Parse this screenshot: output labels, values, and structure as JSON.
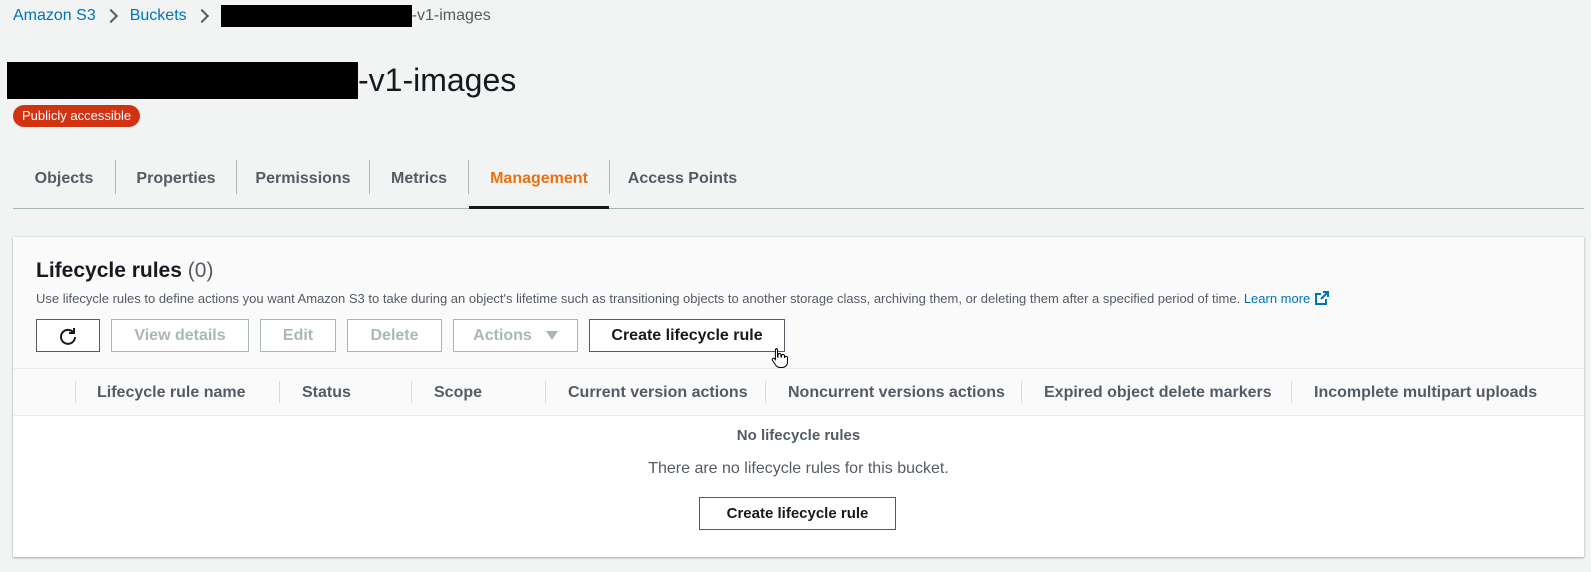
{
  "breadcrumb": {
    "items": [
      "Amazon S3",
      "Buckets"
    ],
    "current_suffix": "-v1-images"
  },
  "bucket": {
    "title_suffix": "-v1-images",
    "badge": "Publicly accessible",
    "badge_color": "#d13212"
  },
  "tabs": [
    {
      "label": "Objects",
      "active": false
    },
    {
      "label": "Properties",
      "active": false
    },
    {
      "label": "Permissions",
      "active": false
    },
    {
      "label": "Metrics",
      "active": false
    },
    {
      "label": "Management",
      "active": true
    },
    {
      "label": "Access Points",
      "active": false
    }
  ],
  "lifecycle": {
    "title": "Lifecycle rules",
    "count": "(0)",
    "description": "Use lifecycle rules to define actions you want Amazon S3 to take during an object's lifetime such as transitioning objects to another storage class, archiving them, or deleting them after a specified period of time.",
    "learn_more": "Learn more",
    "buttons": {
      "refresh_icon": "refresh-icon",
      "view_details": "View details",
      "edit": "Edit",
      "delete": "Delete",
      "actions": "Actions",
      "create": "Create lifecycle rule"
    },
    "columns": [
      "Lifecycle rule name",
      "Status",
      "Scope",
      "Current version actions",
      "Noncurrent versions actions",
      "Expired object delete markers",
      "Incomplete multipart uploads"
    ],
    "empty": {
      "title": "No lifecycle rules",
      "description": "There are no lifecycle rules for this bucket.",
      "button": "Create lifecycle rule"
    }
  },
  "colors": {
    "link": "#0073bb",
    "active_tab": "#ec7211",
    "text": "#16191f",
    "muted": "#545b64"
  }
}
